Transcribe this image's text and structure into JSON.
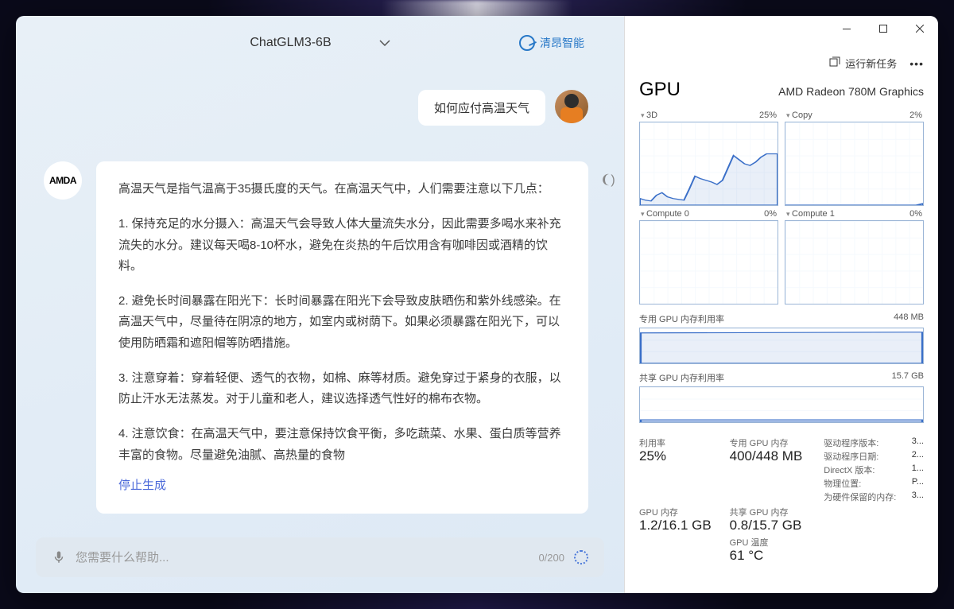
{
  "chat": {
    "model_name": "ChatGLM3-6B",
    "brand": "清昂智能",
    "user_message": "如何应付高温天气",
    "assistant_avatar_label": "AMDA",
    "response_intro": "高温天气是指气温高于35摄氏度的天气。在高温天气中，人们需要注意以下几点：",
    "response_p1": "1. 保持充足的水分摄入：高温天气会导致人体大量流失水分，因此需要多喝水来补充流失的水分。建议每天喝8-10杯水，避免在炎热的午后饮用含有咖啡因或酒精的饮料。",
    "response_p2": "2. 避免长时间暴露在阳光下：长时间暴露在阳光下会导致皮肤晒伤和紫外线感染。在高温天气中，尽量待在阴凉的地方，如室内或树荫下。如果必须暴露在阳光下，可以使用防晒霜和遮阳帽等防晒措施。",
    "response_p3": "3. 注意穿着：穿着轻便、透气的衣物，如棉、麻等材质。避免穿过于紧身的衣服，以防止汗水无法蒸发。对于儿童和老人，建议选择透气性好的棉布衣物。",
    "response_p4": "4. 注意饮食：在高温天气中，要注意保持饮食平衡，多吃蔬菜、水果、蛋白质等营养丰富的食物。尽量避免油腻、高热量的食物",
    "stop_generate": "停止生成",
    "input_placeholder": "您需要什么帮助...",
    "char_count": "0/200"
  },
  "taskmgr": {
    "run_new_task": "运行新任务",
    "gpu_label": "GPU",
    "gpu_model": "AMD Radeon 780M Graphics",
    "charts": {
      "c3d_label": "3D",
      "c3d_val": "25%",
      "copy_label": "Copy",
      "copy_val": "2%",
      "compute0_label": "Compute 0",
      "compute0_val": "0%",
      "compute1_label": "Compute 1",
      "compute1_val": "0%"
    },
    "dedicated_mem_label": "专用 GPU 内存利用率",
    "dedicated_mem_max": "448 MB",
    "shared_mem_label": "共享 GPU 内存利用率",
    "shared_mem_max": "15.7 GB",
    "stats": {
      "util_label": "利用率",
      "util_val": "25%",
      "ded_label": "专用 GPU 内存",
      "ded_val": "400/448 MB",
      "gpu_mem_label": "GPU 内存",
      "gpu_mem_val": "1.2/16.1 GB",
      "shr_label": "共享 GPU 内存",
      "shr_val": "0.8/15.7 GB",
      "temp_label": "GPU 温度",
      "temp_val": "61 °C"
    },
    "driver": {
      "ver_label": "驱动程序版本:",
      "ver_val": "3...",
      "date_label": "驱动程序日期:",
      "date_val": "2...",
      "dx_label": "DirectX 版本:",
      "dx_val": "1...",
      "loc_label": "物理位置:",
      "loc_val": "P...",
      "reserved_label": "为硬件保留的内存:",
      "reserved_val": "3..."
    }
  },
  "chart_data": [
    {
      "type": "line",
      "name": "3D",
      "ylim": [
        0,
        100
      ],
      "unit": "%",
      "current": 25,
      "values": [
        8,
        6,
        5,
        12,
        15,
        10,
        8,
        7,
        6,
        20,
        35,
        32,
        30,
        28,
        25,
        30,
        45,
        60,
        55,
        50,
        48,
        52,
        58,
        62
      ]
    },
    {
      "type": "line",
      "name": "Copy",
      "ylim": [
        0,
        100
      ],
      "unit": "%",
      "current": 2,
      "values": [
        0,
        0,
        0,
        0,
        0,
        0,
        0,
        0,
        0,
        0,
        0,
        0,
        0,
        0,
        0,
        0,
        0,
        0,
        0,
        0,
        0,
        0,
        0,
        2
      ]
    },
    {
      "type": "line",
      "name": "Compute 0",
      "ylim": [
        0,
        100
      ],
      "unit": "%",
      "current": 0,
      "values": [
        0,
        0,
        0,
        0,
        0,
        0,
        0,
        0,
        0,
        0,
        0,
        0,
        0,
        0,
        0,
        0,
        0,
        0,
        0,
        0,
        0,
        0,
        0,
        0
      ]
    },
    {
      "type": "line",
      "name": "Compute 1",
      "ylim": [
        0,
        100
      ],
      "unit": "%",
      "current": 0,
      "values": [
        0,
        0,
        0,
        0,
        0,
        0,
        0,
        0,
        0,
        0,
        0,
        0,
        0,
        0,
        0,
        0,
        0,
        0,
        0,
        0,
        0,
        0,
        0,
        0
      ]
    },
    {
      "type": "area",
      "name": "Dedicated GPU Memory",
      "ylim": [
        0,
        448
      ],
      "unit": "MB",
      "current": 400,
      "values": [
        398,
        398,
        399,
        400,
        399,
        400,
        398,
        399,
        400,
        400,
        399,
        400,
        398,
        400,
        400,
        399,
        400,
        400,
        399,
        400,
        400,
        400,
        399,
        400
      ]
    },
    {
      "type": "area",
      "name": "Shared GPU Memory",
      "ylim": [
        0,
        15.7
      ],
      "unit": "GB",
      "current": 0.8,
      "values": [
        0.78,
        0.79,
        0.8,
        0.8,
        0.79,
        0.8,
        0.81,
        0.8,
        0.79,
        0.8,
        0.8,
        0.8,
        0.81,
        0.8,
        0.79,
        0.8,
        0.8,
        0.8,
        0.81,
        0.8,
        0.79,
        0.8,
        0.8,
        0.8
      ]
    }
  ]
}
